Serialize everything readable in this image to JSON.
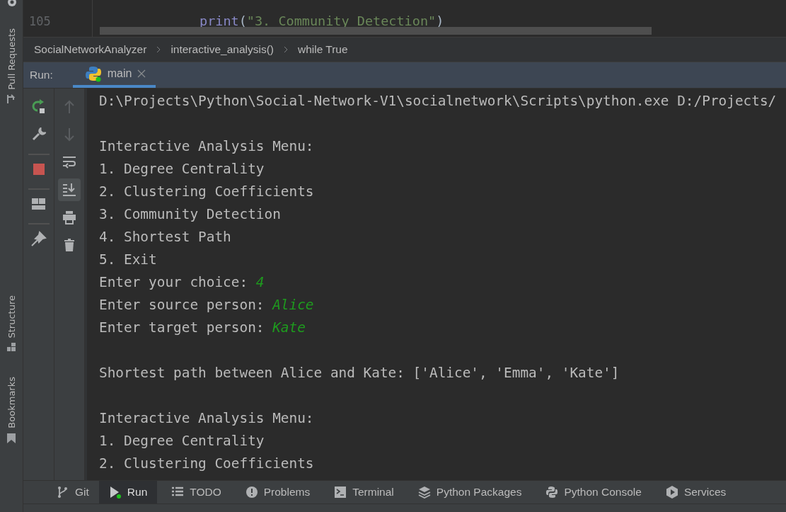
{
  "left_stripe": [
    {
      "label": "Pull Requests",
      "kind": "pull"
    },
    {
      "label": "Structure",
      "kind": "structure"
    },
    {
      "label": "Bookmarks",
      "kind": "bookmark"
    }
  ],
  "editor": {
    "lines": [
      {
        "number": "105",
        "tokens": [
          {
            "kind": "builtin",
            "text": "print"
          },
          {
            "kind": "punct",
            "text": "("
          },
          {
            "kind": "string",
            "text": "\"3. Community Detection\""
          },
          {
            "kind": "punct",
            "text": ")"
          }
        ]
      }
    ]
  },
  "breadcrumbs": [
    "SocialNetworkAnalyzer",
    "interactive_analysis()",
    "while True"
  ],
  "run_panel": {
    "label": "Run:",
    "tabs": [
      {
        "label": "main",
        "selected": true
      }
    ],
    "actions": [
      {
        "kind": "rerun"
      },
      {
        "kind": "wrench"
      },
      {
        "kind": "stop"
      },
      {
        "kind": "layout"
      },
      {
        "kind": "pin"
      }
    ],
    "tools": [
      {
        "kind": "up",
        "disabled": true,
        "on": false
      },
      {
        "kind": "down",
        "disabled": true,
        "on": false
      },
      {
        "kind": "wrap",
        "disabled": false,
        "on": false
      },
      {
        "kind": "scroll-end",
        "disabled": false,
        "on": true
      },
      {
        "kind": "print",
        "disabled": false,
        "on": false
      },
      {
        "kind": "trash",
        "disabled": false,
        "on": false
      }
    ],
    "console": [
      {
        "kind": "output",
        "text": "D:\\Projects\\Python\\Social-Network-V1\\socialnetwork\\Scripts\\python.exe D:/Projects/"
      },
      {
        "kind": "blank"
      },
      {
        "kind": "output",
        "text": "Interactive Analysis Menu:"
      },
      {
        "kind": "output",
        "text": "1. Degree Centrality"
      },
      {
        "kind": "output",
        "text": "2. Clustering Coefficients"
      },
      {
        "kind": "output",
        "text": "3. Community Detection"
      },
      {
        "kind": "output",
        "text": "4. Shortest Path"
      },
      {
        "kind": "output",
        "text": "5. Exit"
      },
      {
        "kind": "prompt",
        "text": "Enter your choice: ",
        "input": "4"
      },
      {
        "kind": "prompt",
        "text": "Enter source person: ",
        "input": "Alice"
      },
      {
        "kind": "prompt",
        "text": "Enter target person: ",
        "input": "Kate"
      },
      {
        "kind": "blank"
      },
      {
        "kind": "output",
        "text": "Shortest path between Alice and Kate: ['Alice', 'Emma', 'Kate']"
      },
      {
        "kind": "blank"
      },
      {
        "kind": "output",
        "text": "Interactive Analysis Menu:"
      },
      {
        "kind": "output",
        "text": "1. Degree Centrality"
      },
      {
        "kind": "output",
        "text": "2. Clustering Coefficients"
      }
    ]
  },
  "tool_windows": [
    {
      "label": "Git",
      "kind": "git",
      "selected": false
    },
    {
      "label": "Run",
      "kind": "run",
      "selected": true
    },
    {
      "label": "TODO",
      "kind": "todo",
      "selected": false
    },
    {
      "label": "Problems",
      "kind": "problems",
      "selected": false
    },
    {
      "label": "Terminal",
      "kind": "terminal",
      "selected": false
    },
    {
      "label": "Python Packages",
      "kind": "packages",
      "selected": false
    },
    {
      "label": "Python Console",
      "kind": "python",
      "selected": false
    },
    {
      "label": "Services",
      "kind": "services",
      "selected": false
    }
  ]
}
